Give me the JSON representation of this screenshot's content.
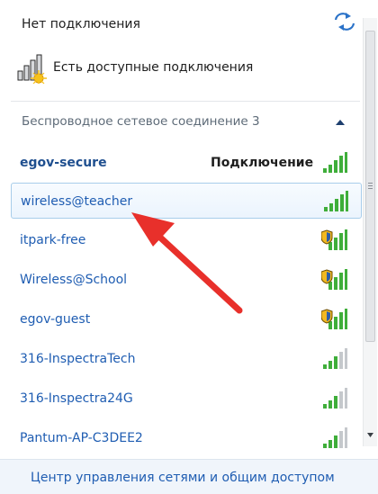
{
  "panel": {
    "status_title": "Нет подключения",
    "available_text": "Есть доступные подключения",
    "section_title": "Беспроводное сетевое соединение 3",
    "footer_link": "Центр управления сетями и общим доступом"
  },
  "networks": [
    {
      "name": "egov-secure",
      "status": "Подключение",
      "secured": false,
      "bold": true
    },
    {
      "name": "wireless@teacher",
      "status": "",
      "secured": false,
      "hover": true
    },
    {
      "name": "itpark-free",
      "status": "",
      "secured": true
    },
    {
      "name": "Wireless@School",
      "status": "",
      "secured": true
    },
    {
      "name": "egov-guest",
      "status": "",
      "secured": true
    },
    {
      "name": "316-InspectraTech",
      "status": "",
      "secured": false
    },
    {
      "name": "316-Inspectra24G",
      "status": "",
      "secured": false
    },
    {
      "name": "Pantum-AP-C3DEE2",
      "status": "",
      "secured": false
    }
  ],
  "icons": {
    "refresh": "refresh-icon",
    "network_status": "network-status-icon",
    "collapse": "chevron-up-icon",
    "signal": "wifi-signal-icon",
    "shield": "security-shield-icon",
    "annotation": "red-arrow-annotation"
  },
  "colors": {
    "link": "#1f5db2",
    "signal_green": "#3fae3a",
    "annotation_red": "#e8302b",
    "footer_bg": "#f0f5fb"
  }
}
